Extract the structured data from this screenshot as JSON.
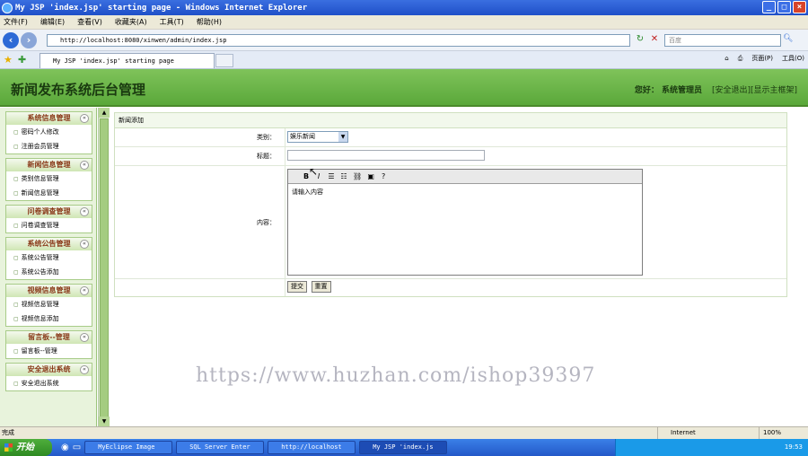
{
  "window": {
    "title": "My JSP 'index.jsp' starting page - Windows Internet Explorer"
  },
  "menu": [
    "文件(F)",
    "编辑(E)",
    "查看(V)",
    "收藏夹(A)",
    "工具(T)",
    "帮助(H)"
  ],
  "address": {
    "url": "http://localhost:8080/xinwen/admin/index.jsp",
    "search_placeholder": "百度"
  },
  "tab": {
    "label": "My JSP 'index.jsp' starting page"
  },
  "toolbar": {
    "page": "页面(P)",
    "tools": "工具(O)"
  },
  "header": {
    "title": "新闻发布系统后台管理",
    "welcome": "您好： 系统管理员",
    "logout": "[安全退出]",
    "home": "[显示主框架]"
  },
  "sidebar": {
    "groups": [
      {
        "title": "系统信息管理",
        "items": [
          "密码个人修改",
          "注册会员管理"
        ]
      },
      {
        "title": "新闻信息管理",
        "items": [
          "类别信息管理",
          "新闻信息管理"
        ]
      },
      {
        "title": "问卷调查管理",
        "items": [
          "问卷调查管理"
        ]
      },
      {
        "title": "系统公告管理",
        "items": [
          "系统公告管理",
          "系统公告添加"
        ]
      },
      {
        "title": "视频信息管理",
        "items": [
          "视频信息管理",
          "视频信息添加"
        ]
      },
      {
        "title": "留言板--管理",
        "items": [
          "留言板--管理"
        ]
      },
      {
        "title": "安全退出系统",
        "items": [
          "安全退出系统"
        ]
      }
    ]
  },
  "form": {
    "title": "新闻添加",
    "category_label": "类别：",
    "category_value": "娱乐新闻",
    "subject_label": "标题：",
    "content_label": "内容：",
    "content_placeholder": "请输入内容",
    "submit": "提交",
    "reset": "重置"
  },
  "watermark": "https://www.huzhan.com/ishop39397",
  "status": {
    "left": "完成",
    "zone": "Internet",
    "zoom": "100%"
  },
  "taskbar": {
    "start": "开始",
    "tasks": [
      "MyEclipse Image",
      "SQL Server Enter",
      "http://localhost",
      "My JSP 'index.js"
    ],
    "time": "19:53"
  }
}
